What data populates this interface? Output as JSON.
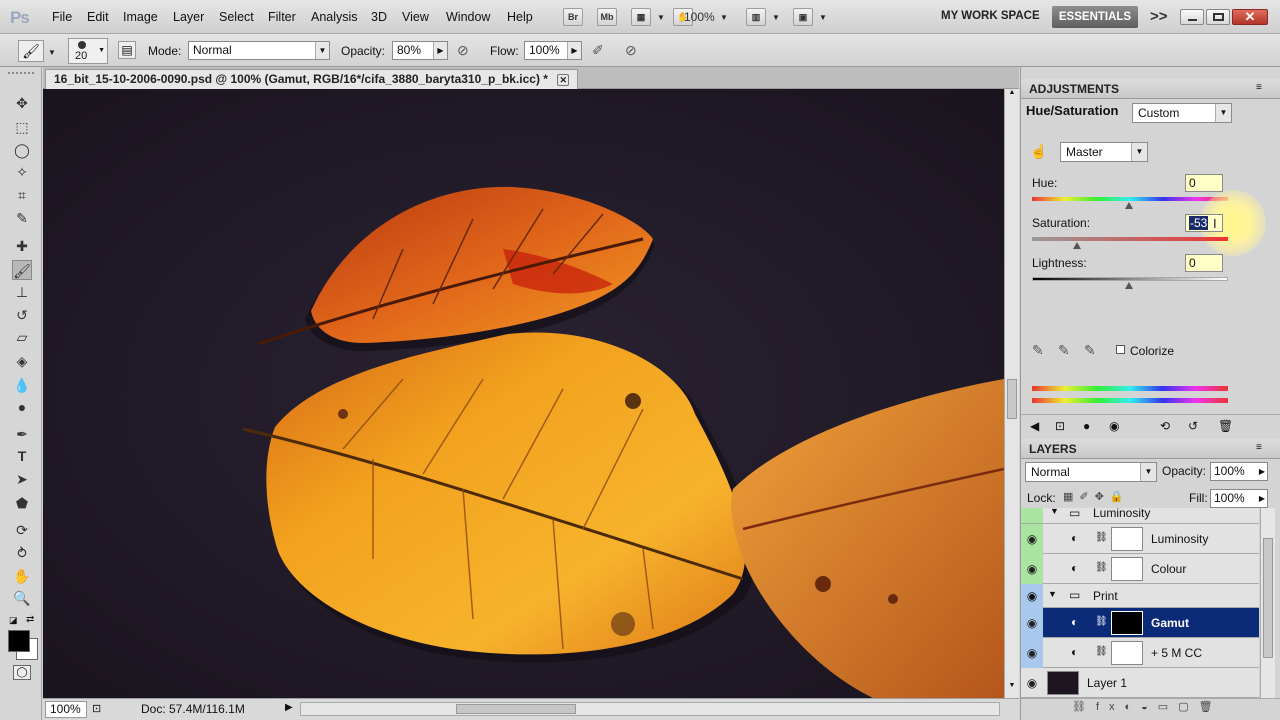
{
  "app": {
    "logo": "Ps"
  },
  "menu": [
    "File",
    "Edit",
    "Image",
    "Layer",
    "Select",
    "Filter",
    "Analysis",
    "3D",
    "View",
    "Window",
    "Help"
  ],
  "menubar_buttons": {
    "br": "Br",
    "mb": "Mb",
    "zoom": "100%"
  },
  "workspace": {
    "label": "MY WORK SPACE",
    "active": "ESSENTIALS",
    "more": ">>"
  },
  "options": {
    "brush_size": "20",
    "mode_label": "Mode:",
    "mode_value": "Normal",
    "opacity_label": "Opacity:",
    "opacity_value": "80%",
    "flow_label": "Flow:",
    "flow_value": "100%"
  },
  "document": {
    "tab_title": "16_bit_15-10-2006-0090.psd @ 100% (Gamut, RGB/16*/cifa_3880_baryta310_p_bk.icc) *",
    "zoom": "100%",
    "doc_size": "Doc: 57.4M/116.1M"
  },
  "adjustments": {
    "tab": "ADJUSTMENTS",
    "title": "Hue/Saturation",
    "preset": "Custom",
    "channel": "Master",
    "hue_label": "Hue:",
    "hue_value": "0",
    "sat_label": "Saturation:",
    "sat_value": "-53",
    "light_label": "Lightness:",
    "light_value": "0",
    "colorize_label": "Colorize"
  },
  "layers": {
    "tab": "LAYERS",
    "blend_mode": "Normal",
    "opacity_label": "Opacity:",
    "opacity_value": "100%",
    "lock_label": "Lock:",
    "fill_label": "Fill:",
    "fill_value": "100%",
    "items": [
      {
        "name": "Luminosity",
        "kind": "group-partial"
      },
      {
        "name": "Luminosity",
        "kind": "adjustment"
      },
      {
        "name": "Colour",
        "kind": "adjustment"
      },
      {
        "name": "Print",
        "kind": "group"
      },
      {
        "name": "Gamut",
        "kind": "adjustment-selected"
      },
      {
        "name": "+ 5 M CC",
        "kind": "adjustment"
      },
      {
        "name": "Layer 1",
        "kind": "pixel"
      }
    ]
  },
  "colors": {
    "selected_layer": "#0b2a78",
    "eye_green": "#a9e5a0",
    "eye_blue": "#a8c8ee",
    "workspace_active": "#6e6e6e"
  }
}
